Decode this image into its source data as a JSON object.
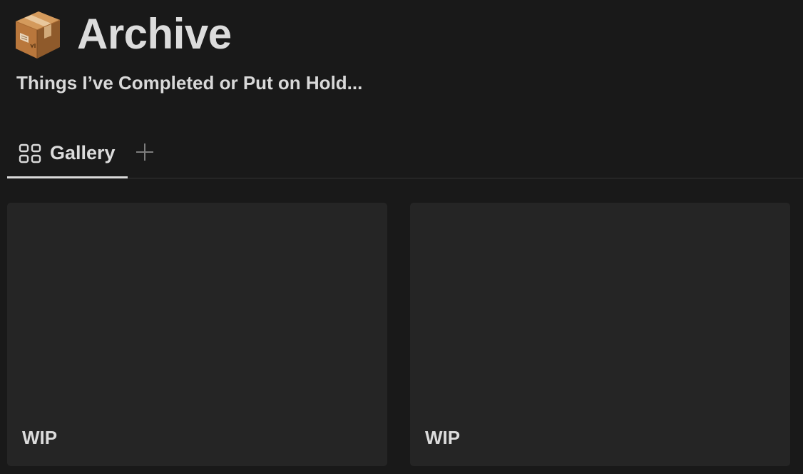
{
  "page": {
    "icon": "package-box-icon",
    "title": "Archive",
    "subtitle": "Things I’ve Completed or Put on Hold..."
  },
  "views": {
    "tabs": [
      {
        "label": "Gallery",
        "icon": "gallery-grid-icon",
        "active": true
      }
    ],
    "add_view_icon": "plus-icon"
  },
  "gallery": {
    "cards": [
      {
        "title": "WIP"
      },
      {
        "title": "WIP"
      }
    ]
  },
  "colors": {
    "background": "#191919",
    "card": "#252525",
    "text": "#d9d9d9",
    "divider": "#333333"
  }
}
